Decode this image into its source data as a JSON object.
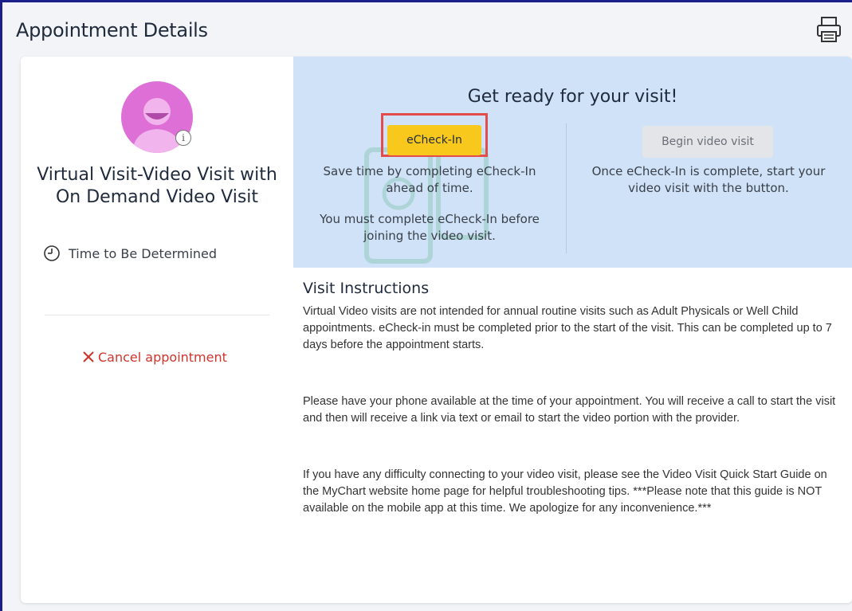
{
  "header": {
    "title": "Appointment Details",
    "print_icon": "printer-icon"
  },
  "appointment": {
    "visit_title": "Virtual Visit-Video Visit with On Demand Video Visit",
    "time": "Time to Be Determined",
    "cancel_label": "Cancel appointment",
    "avatar_icon": "user-avatar-icon",
    "info_badge": "i"
  },
  "ready": {
    "title": "Get ready for your visit!",
    "echeck_button": "eCheck-In",
    "echeck_desc_1": "Save time by completing eCheck-In ahead of time.",
    "echeck_desc_2": "You must complete eCheck-In before joining the video visit.",
    "video_button": "Begin video visit",
    "video_desc": "Once eCheck-In is complete, start your video visit with the button."
  },
  "instructions": {
    "title": "Visit Instructions",
    "paragraphs": [
      "Virtual Video visits are not intended for annual routine visits such as Adult Physicals or Well Child appointments. eCheck-in must be completed prior to the start of the visit. This can be completed up to 7 days before the appointment starts.",
      "Please have your phone available at the time of your appointment. You will receive a call to start the visit and then will receive a link via text or email to start the video portion with the provider.",
      "If you have any difficulty connecting to your video visit, please see the Video Visit Quick Start Guide on the MyChart website home page for helpful troubleshooting tips. ***Please note that this guide is NOT available on the mobile app at this time.  We apologize for any inconvenience.***"
    ]
  },
  "colors": {
    "accent_yellow": "#f8c81c",
    "highlight_red": "#e44b4b",
    "panel_blue": "#cfe2f7",
    "cancel_red": "#d0342c",
    "avatar_pink": "#de6fd6"
  }
}
